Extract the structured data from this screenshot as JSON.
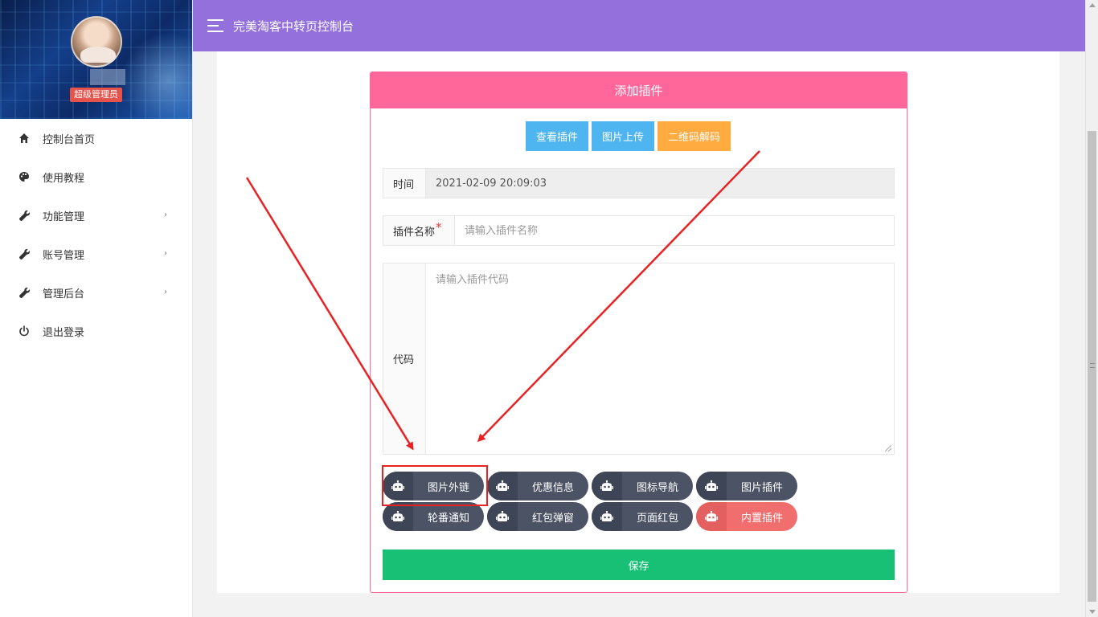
{
  "app": {
    "title": "完美淘客中转页控制台"
  },
  "sidebar": {
    "role_badge": "超级管理员",
    "items": [
      {
        "label": "控制台首页",
        "icon": "home-icon"
      },
      {
        "label": "使用教程",
        "icon": "palette-icon"
      },
      {
        "label": "功能管理",
        "icon": "wrench-icon",
        "expand": "›"
      },
      {
        "label": "账号管理",
        "icon": "wrench-icon",
        "expand": "›"
      },
      {
        "label": "管理后台",
        "icon": "wrench-icon",
        "expand": "›"
      },
      {
        "label": "退出登录",
        "icon": "power-icon"
      }
    ]
  },
  "card": {
    "title": "添加插件",
    "buttons": {
      "view": "查看插件",
      "upload": "图片上传",
      "qr": "二维码解码"
    },
    "time": {
      "label": "时间",
      "value": "2021-02-09 20:09:03"
    },
    "name": {
      "label": "插件名称",
      "required_mark": "*",
      "placeholder": "请输入插件名称"
    },
    "code": {
      "label": "代码",
      "placeholder": "请输入插件代码"
    },
    "plugins": [
      {
        "label": "图片外链",
        "style": "dark"
      },
      {
        "label": "优惠信息",
        "style": "dark"
      },
      {
        "label": "图标导航",
        "style": "dark"
      },
      {
        "label": "图片插件",
        "style": "dark"
      },
      {
        "label": "轮番通知",
        "style": "dark"
      },
      {
        "label": "红包弹窗",
        "style": "dark"
      },
      {
        "label": "页面红包",
        "style": "dark"
      },
      {
        "label": "内置插件",
        "style": "red"
      }
    ],
    "save": "保存"
  },
  "colors": {
    "header": "#9370db",
    "card_header": "#ff6699",
    "btn_blue": "#4fb5f0",
    "btn_orange": "#ffab40",
    "save": "#17c074",
    "annotation": "#e82222"
  }
}
